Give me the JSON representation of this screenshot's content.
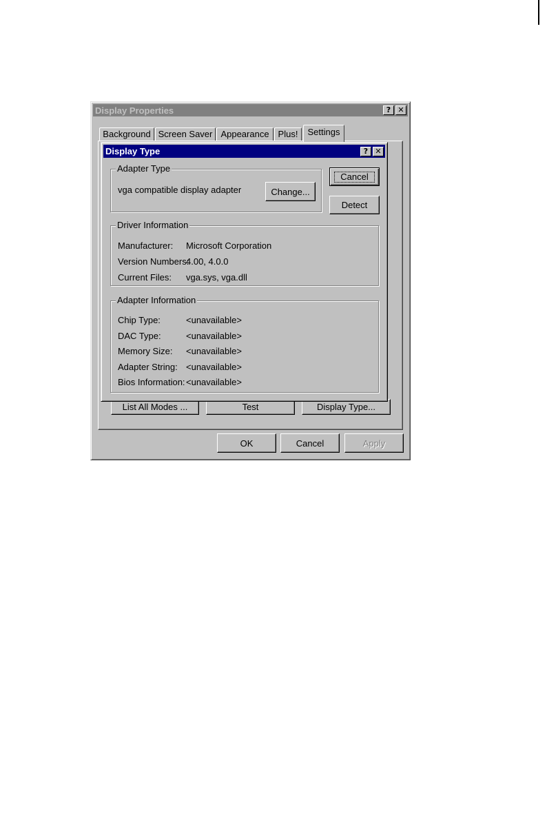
{
  "display_properties": {
    "title": "Display Properties",
    "help_glyph": "?",
    "close_glyph": "✕",
    "tabs": [
      {
        "label": "Background"
      },
      {
        "label": "Screen Saver"
      },
      {
        "label": "Appearance"
      },
      {
        "label": "Plus!"
      },
      {
        "label": "Settings"
      }
    ],
    "active_tab": "Settings",
    "settings_buttons": {
      "list_all_modes": "List All Modes ...",
      "test": "Test",
      "display_type": "Display Type..."
    },
    "footer": {
      "ok": "OK",
      "cancel": "Cancel",
      "apply": "Apply"
    }
  },
  "display_type": {
    "title": "Display Type",
    "help_glyph": "?",
    "close_glyph": "✕",
    "cancel_label": "Cancel",
    "detect_label": "Detect",
    "adapter_type": {
      "legend": "Adapter Type",
      "value": "vga compatible display adapter",
      "change_label": "Change..."
    },
    "driver_information": {
      "legend": "Driver Information",
      "rows": [
        {
          "label": "Manufacturer:",
          "value": "Microsoft Corporation"
        },
        {
          "label": "Version Numbers:",
          "value": "4.00, 4.0.0"
        },
        {
          "label": "Current Files:",
          "value": "vga.sys, vga.dll"
        }
      ]
    },
    "adapter_information": {
      "legend": "Adapter Information",
      "rows": [
        {
          "label": "Chip Type:",
          "value": "<unavailable>"
        },
        {
          "label": "DAC Type:",
          "value": "<unavailable>"
        },
        {
          "label": "Memory Size:",
          "value": "<unavailable>"
        },
        {
          "label": "Adapter String:",
          "value": "<unavailable>"
        },
        {
          "label": "Bios Information:",
          "value": "<unavailable>"
        }
      ]
    }
  }
}
